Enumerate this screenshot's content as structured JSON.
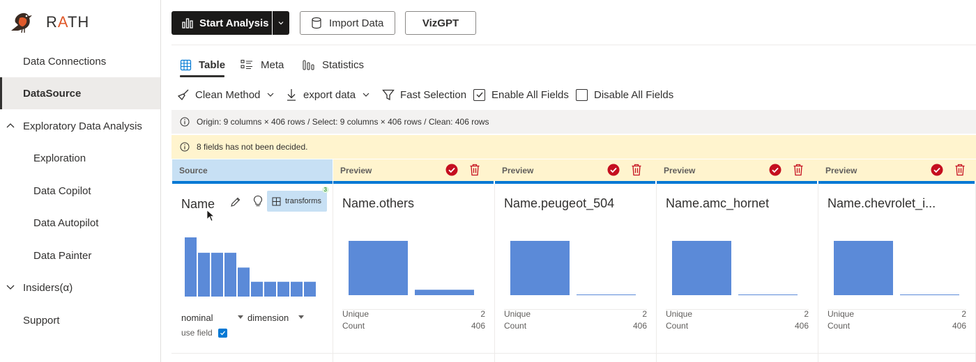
{
  "app": {
    "logo_text_r": "R",
    "logo_text_a": "A",
    "logo_text_th": "TH",
    "accent": "#e05a2b"
  },
  "sidebar": {
    "items": [
      {
        "label": "Data Connections",
        "active": false
      },
      {
        "label": "DataSource",
        "active": true
      },
      {
        "label": "Exploratory Data Analysis",
        "expanded": true
      },
      {
        "label": "Exploration"
      },
      {
        "label": "Data Copilot"
      },
      {
        "label": "Data Autopilot"
      },
      {
        "label": "Data Painter"
      },
      {
        "label": "Insiders(α)",
        "expanded": false
      },
      {
        "label": "Support"
      }
    ]
  },
  "toolbar": {
    "start_analysis": "Start Analysis",
    "import_data": "Import Data",
    "vizgpt": "VizGPT"
  },
  "tabs": [
    {
      "label": "Table",
      "active": true,
      "icon": "table-icon"
    },
    {
      "label": "Meta",
      "active": false,
      "icon": "meta-icon"
    },
    {
      "label": "Statistics",
      "active": false,
      "icon": "statistics-icon"
    }
  ],
  "commands": {
    "clean_method": "Clean Method",
    "export_data": "export data",
    "fast_selection": "Fast Selection",
    "enable_all": "Enable All Fields",
    "disable_all": "Disable All Fields"
  },
  "info_message": "Origin: 9 columns × 406 rows / Select: 9 columns × 406 rows / Clean: 406 rows",
  "warning_message": "8 fields has not been decided.",
  "source_column": {
    "header": "Source",
    "name": "Name",
    "transforms_label": "transforms",
    "transforms_count": "3",
    "semantic_type": "nominal",
    "analytic_type": "dimension",
    "use_field_label": "use field",
    "use_field_checked": true,
    "histogram": [
      1.0,
      0.74,
      0.74,
      0.74,
      0.49,
      0.25,
      0.25,
      0.25,
      0.25,
      0.25
    ]
  },
  "preview_columns": [
    {
      "header": "Preview",
      "name": "Name.others",
      "unique_label": "Unique",
      "unique": "2",
      "count_label": "Count",
      "count": "406",
      "bars": [
        1.0,
        0.1
      ]
    },
    {
      "header": "Preview",
      "name": "Name.peugeot_504",
      "unique_label": "Unique",
      "unique": "2",
      "count_label": "Count",
      "count": "406",
      "bars": [
        1.0,
        0.01
      ]
    },
    {
      "header": "Preview",
      "name": "Name.amc_hornet",
      "unique_label": "Unique",
      "unique": "2",
      "count_label": "Count",
      "count": "406",
      "bars": [
        1.0,
        0.01
      ]
    },
    {
      "header": "Preview",
      "name": "Name.chevrolet_i...",
      "unique_label": "Unique",
      "unique": "2",
      "count_label": "Count",
      "count": "406",
      "bars": [
        1.0,
        0.01
      ]
    }
  ],
  "colors": {
    "bar": "#5b8ad8",
    "accept": "#c50f1f",
    "delete": "#c50f1f",
    "primary_blue": "#0078d4"
  }
}
